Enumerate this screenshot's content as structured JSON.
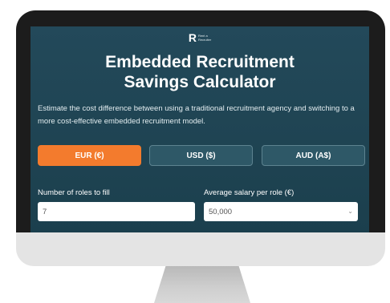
{
  "brand": {
    "logo_letter": "R",
    "name_line1": "Rent a",
    "name_line2": "Recruiter"
  },
  "header": {
    "title_line1": "Embedded Recruitment",
    "title_line2": "Savings Calculator"
  },
  "description": "Estimate the cost difference between using a traditional recruitment agency and switching to a more cost-effective embedded recruitment model.",
  "currency": {
    "options": [
      "EUR (€)",
      "USD ($)",
      "AUD (A$)"
    ],
    "selected": "EUR (€)"
  },
  "form": {
    "roles_label": "Number of roles to fill",
    "roles_value": "7",
    "salary_label": "Average salary per role (€)",
    "salary_value": "50,000"
  },
  "colors": {
    "accent": "#f37b2d",
    "panel_bg": "#23495a",
    "bezel": "#1c1c1c"
  }
}
